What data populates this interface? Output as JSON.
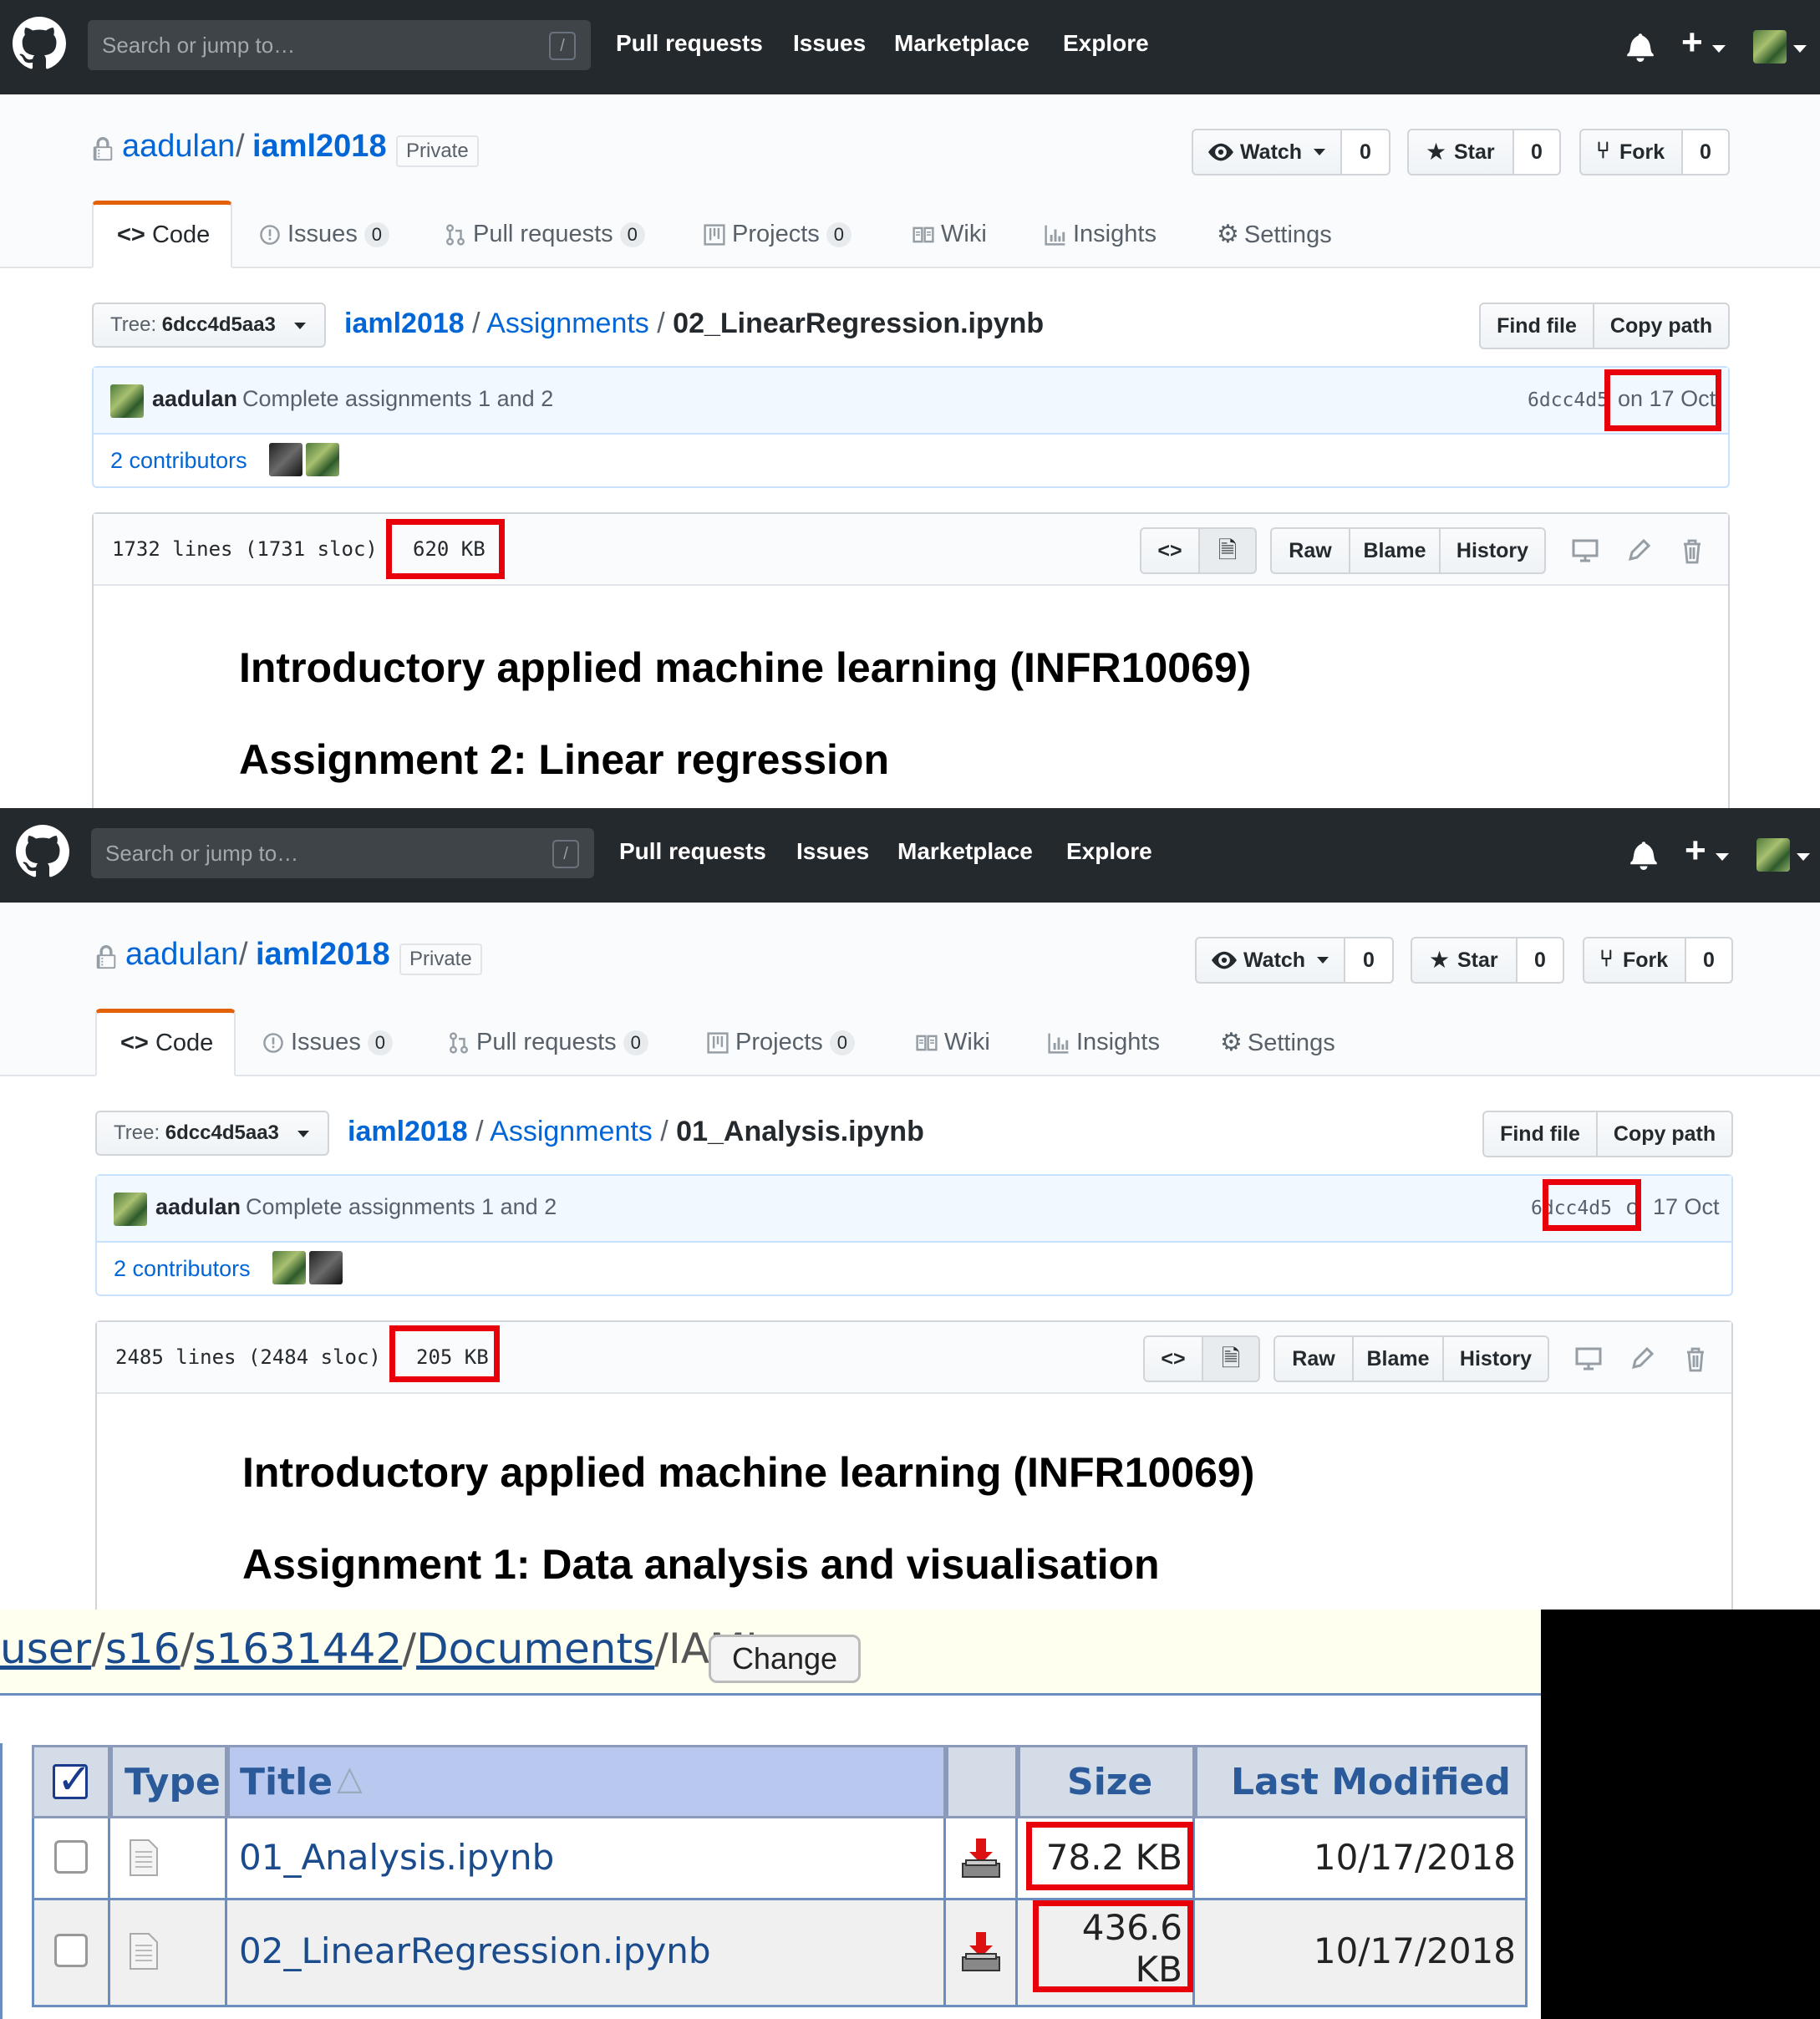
{
  "github": {
    "search_placeholder": "Search or jump to…",
    "search_key": "/",
    "nav": [
      "Pull requests",
      "Issues",
      "Marketplace",
      "Explore"
    ],
    "owner": "aadulan",
    "separator": "/",
    "repo": "iaml2018",
    "private_label": "Private",
    "watch_label": "Watch",
    "watch_count": "0",
    "star_label": "Star",
    "star_count": "0",
    "fork_label": "Fork",
    "fork_count": "0",
    "tabs": {
      "code": "Code",
      "issues": "Issues",
      "issues_count": "0",
      "pulls": "Pull requests",
      "pulls_count": "0",
      "projects": "Projects",
      "projects_count": "0",
      "wiki": "Wiki",
      "insights": "Insights",
      "settings": "Settings"
    },
    "tree_label": "Tree:",
    "tree_sha": "6dcc4d5aa3",
    "find_file": "Find file",
    "copy_path": "Copy path",
    "crumb_repo": "iaml2018",
    "crumb_folder": "Assignments",
    "commit_author": "aadulan",
    "commit_message": "Complete assignments 1 and 2",
    "commit_sha": "6dcc4d5",
    "contributors": "2 contributors",
    "raw": "Raw",
    "blame": "Blame",
    "history": "History",
    "notebook_title": "Introductory applied machine learning (INFR10069)"
  },
  "shot1": {
    "filename": "02_LinearRegression.ipynb",
    "commit_date": "on 17 Oct",
    "lines": "1732 lines (1731 sloc)",
    "size": "620 KB",
    "assignment_heading": "Assignment 2: Linear regression"
  },
  "shot2": {
    "filename": "01_Analysis.ipynb",
    "commit_date_prefix": "o",
    "commit_date": "17 Oct",
    "lines": "2485 lines (2484 sloc)",
    "size": "205 KB",
    "assignment_heading": "Assignment 1: Data analysis and visualisation"
  },
  "filemanager": {
    "path_links": [
      "user",
      "s16",
      "s1631442",
      "Documents"
    ],
    "path_current": "IAML",
    "change_button": "Change",
    "columns": {
      "type": "Type",
      "title": "Title",
      "size": "Size",
      "modified": "Last Modified"
    },
    "rows": [
      {
        "name": "01_Analysis.ipynb",
        "size": "78.2 KB",
        "modified": "10/17/2018"
      },
      {
        "name": "02_LinearRegression.ipynb",
        "size_line1": "436.6",
        "size_line2": "KB",
        "modified": "10/17/2018"
      }
    ]
  },
  "colors": {
    "github_header": "#24292e",
    "link": "#0366d6",
    "highlight": "#e8000b",
    "tab_accent": "#e36209"
  }
}
